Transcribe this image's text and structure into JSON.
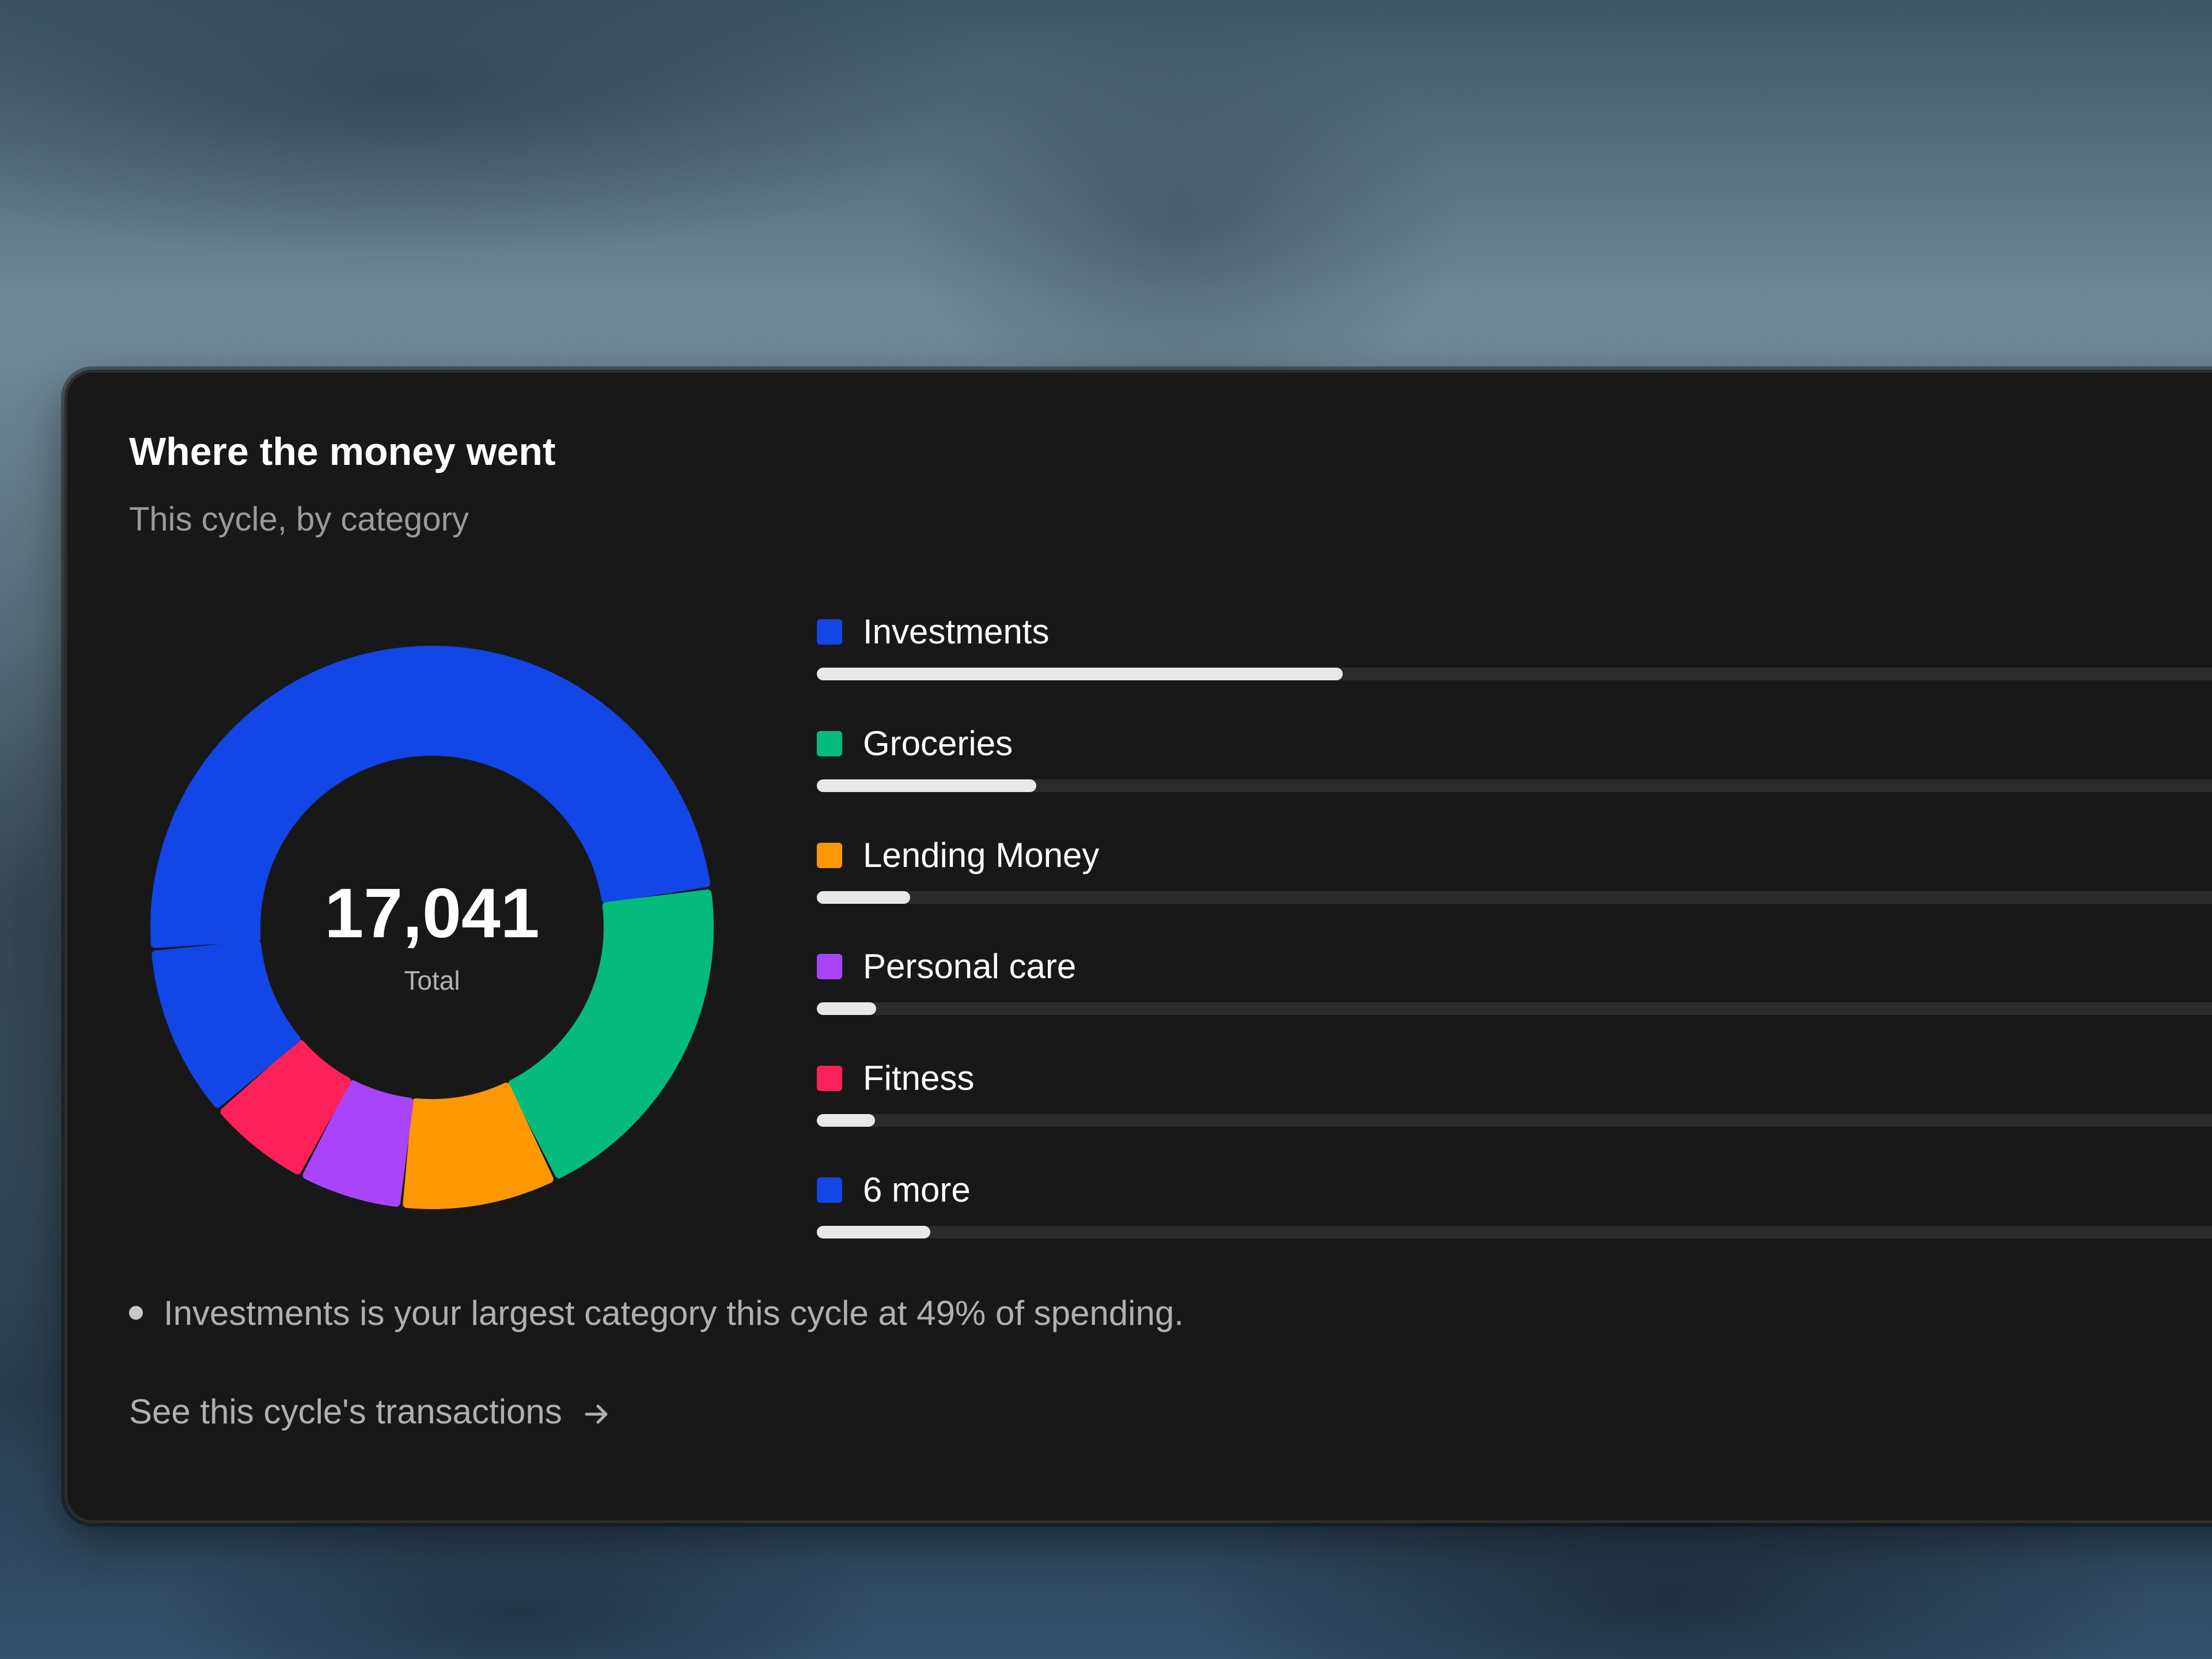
{
  "card": {
    "title": "Where the money went",
    "subtitle": "This cycle, by category"
  },
  "donut": {
    "total_value": "17,041",
    "total_label": "Total",
    "segments": [
      {
        "name": "Investments",
        "color": "#1246e6",
        "percent": 49
      },
      {
        "name": "Groceries",
        "color": "#04bb7d",
        "percent": 20
      },
      {
        "name": "Lending Money",
        "color": "#fd9703",
        "percent": 9
      },
      {
        "name": "Personal care",
        "color": "#a944fa",
        "percent": 6
      },
      {
        "name": "Fitness",
        "color": "#fc2158",
        "percent": 6
      },
      {
        "name": "6 more",
        "color": "#1246e6",
        "percent": 10
      }
    ]
  },
  "legend": [
    {
      "label": "Investments",
      "color": "#1246e6",
      "bar_fraction": 0.371
    },
    {
      "label": "Groceries",
      "color": "#04bb7d",
      "bar_fraction": 0.155
    },
    {
      "label": "Lending Money",
      "color": "#fd9703",
      "bar_fraction": 0.066
    },
    {
      "label": "Personal care",
      "color": "#a944fa",
      "bar_fraction": 0.042
    },
    {
      "label": "Fitness",
      "color": "#fc2158",
      "bar_fraction": 0.041
    },
    {
      "label": "6 more",
      "color": "#1246e6",
      "bar_fraction": 0.08
    }
  ],
  "insight": {
    "text": "Investments is your largest category this cycle at 49% of spending."
  },
  "footer": {
    "link_label": "See this cycle's transactions",
    "link_icon": "arrow-right-icon"
  }
}
